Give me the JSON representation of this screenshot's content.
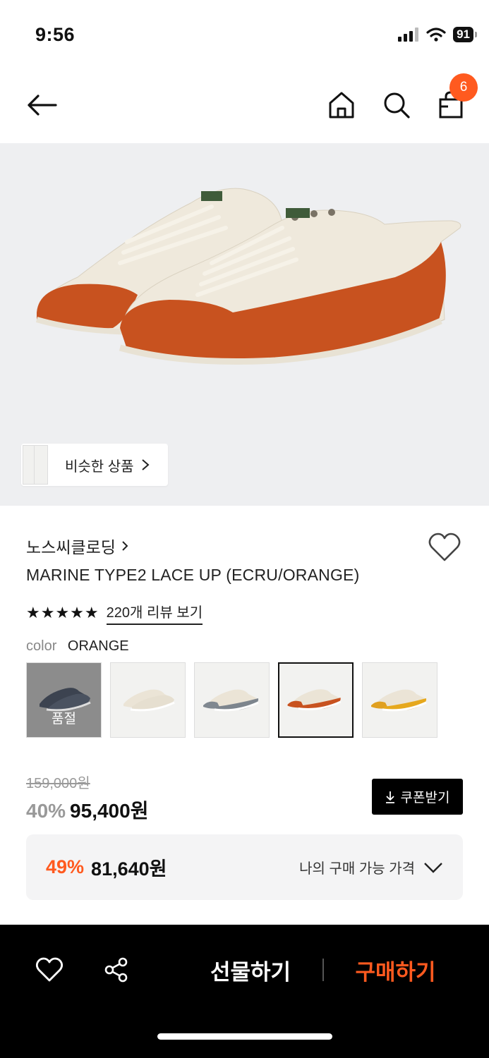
{
  "status_bar": {
    "time": "9:56",
    "battery": "91"
  },
  "nav": {
    "cart_count": "6"
  },
  "hero": {
    "similar_label": "비슷한 상품"
  },
  "product": {
    "brand": "노스씨클로딩",
    "name": "MARINE TYPE2 LACE UP (ECRU/ORANGE)",
    "rating_stars": "★★★★★",
    "review_link": "220개 리뷰 보기",
    "color_label": "color",
    "color_value": "ORANGE",
    "swatches": [
      {
        "color": "navy",
        "sold_out": true,
        "sold_out_label": "품절"
      },
      {
        "color": "ecru",
        "sold_out": false
      },
      {
        "color": "gray",
        "sold_out": false
      },
      {
        "color": "orange",
        "sold_out": false,
        "selected": true
      },
      {
        "color": "yellow",
        "sold_out": false
      }
    ]
  },
  "pricing": {
    "original_price": "159,000원",
    "discount_rate": "40%",
    "sale_price": "95,400원",
    "coupon_button": "쿠폰받기",
    "my_discount_rate": "49%",
    "my_price": "81,640원",
    "my_price_label": "나의 구매 가능 가격"
  },
  "bottom_bar": {
    "gift_label": "선물하기",
    "buy_label": "구매하기"
  },
  "colors": {
    "accent": "#ff5a1f",
    "shoe_body": "#efe9dc",
    "shoe_toe": "#c8521f"
  }
}
